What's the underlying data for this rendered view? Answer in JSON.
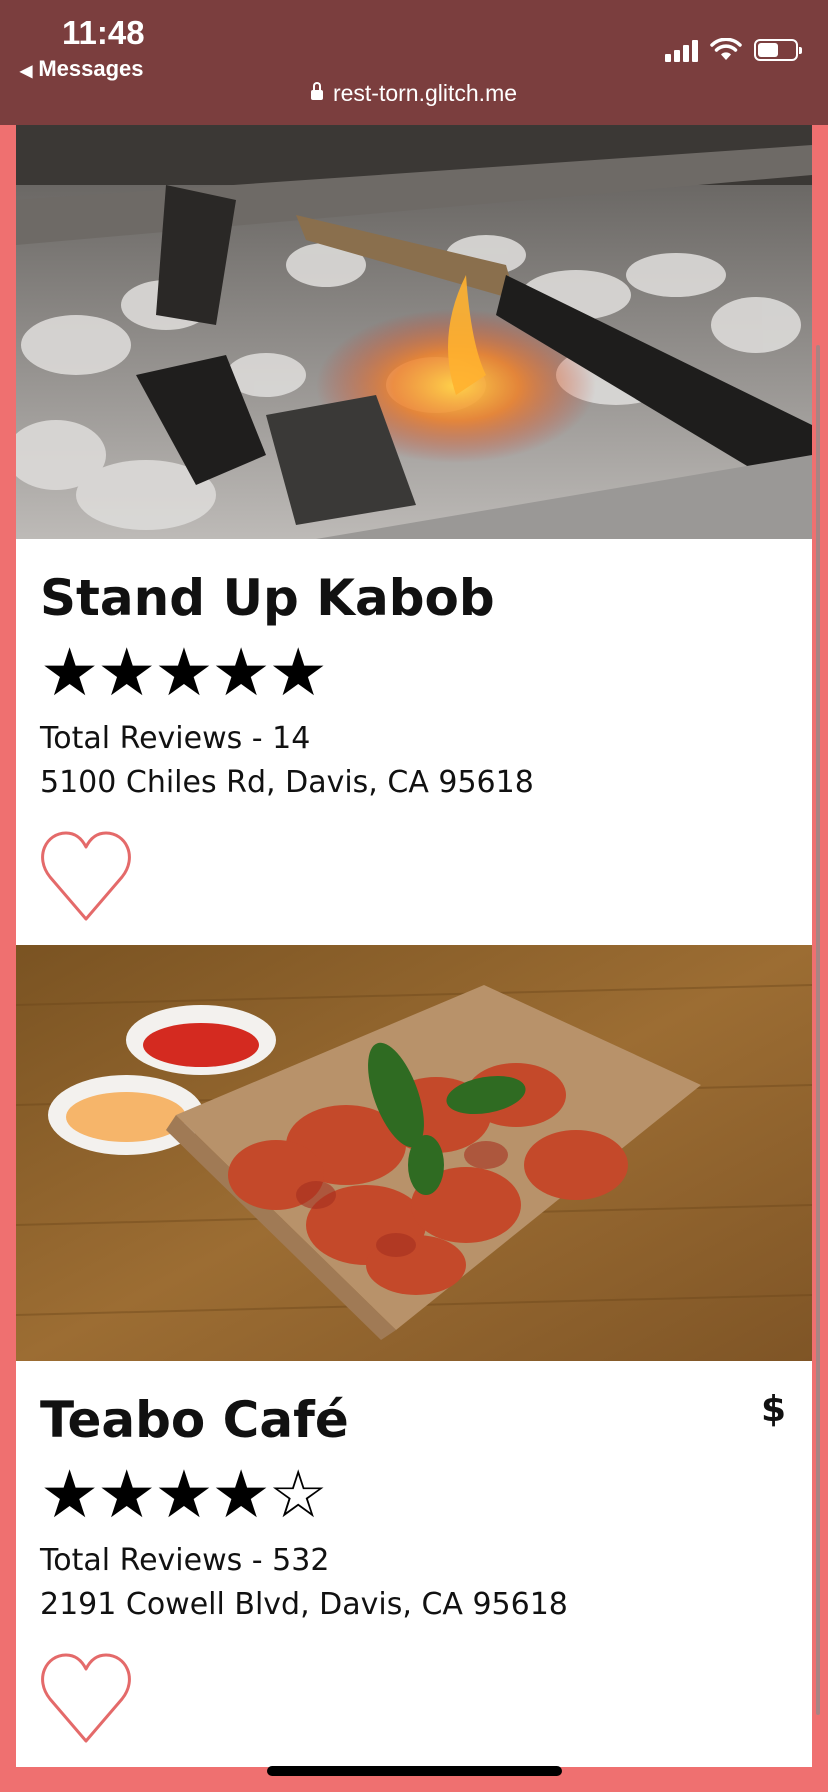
{
  "status_bar": {
    "time": "11:48",
    "back_label": "Messages",
    "url": "rest-torn.glitch.me",
    "icons": [
      "signal-icon",
      "wifi-icon",
      "battery-icon"
    ],
    "battery_level": 0.55
  },
  "restaurants": [
    {
      "name": "Stand Up Kabob",
      "price": "",
      "rating": 5,
      "stars_text": "★★★★★",
      "reviews": "Total Reviews - 14",
      "address": "5100 Chiles Rd, Davis, CA 95618",
      "image": "kabob-on-grill-photo",
      "favorited": false
    },
    {
      "name": "Teabo Café",
      "price": "$",
      "rating": 4,
      "stars_text": "★★★★☆",
      "reviews": "Total Reviews - 532",
      "address": "2191 Cowell Blvd, Davis, CA 95618",
      "image": "fried-chicken-with-sauces-photo",
      "favorited": false
    }
  ],
  "colors": {
    "browser_bar": "#7b3e3e",
    "page_background": "#ef7070",
    "heart_outline": "#e46a6a"
  }
}
